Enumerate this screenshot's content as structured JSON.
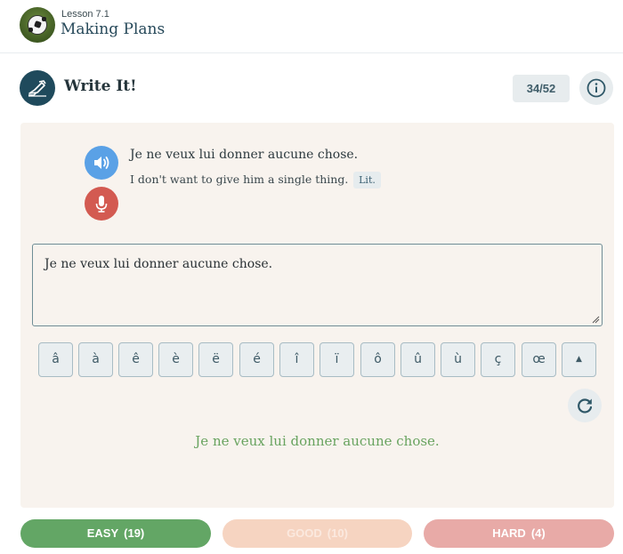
{
  "lesson": {
    "number": "Lesson 7.1",
    "title": "Making Plans",
    "avatar_icon": "soccer-ball-icon"
  },
  "exercise": {
    "title": "Write It!",
    "icon": "pen-hand-icon",
    "counter": "34/52",
    "info_icon": "info-icon"
  },
  "prompt": {
    "sentence": "Je ne veux lui donner aucune chose.",
    "translation": "I don't want to give him a single thing.",
    "literal_badge": "Lit.",
    "speaker_icon": "speaker-icon",
    "mic_icon": "microphone-icon"
  },
  "answer": {
    "value": "Je ne veux lui donner aucune chose."
  },
  "accent_keys": [
    "â",
    "à",
    "ê",
    "è",
    "ë",
    "é",
    "î",
    "ï",
    "ô",
    "û",
    "ù",
    "ç",
    "œ",
    "▲"
  ],
  "correct_answer": "Je ne veux lui donner aucune chose.",
  "ratings": {
    "easy": {
      "label": "EASY",
      "count": "(19)"
    },
    "good": {
      "label": "GOOD",
      "count": "(10)"
    },
    "hard": {
      "label": "HARD",
      "count": "(4)"
    }
  },
  "colors": {
    "accent_dark": "#1f4a5c",
    "speaker": "#5aa1e6",
    "mic": "#d35a51",
    "correct": "#68a35f",
    "easy": "#63a665",
    "good": "#f6d4c1",
    "hard": "#e8aaa7"
  }
}
